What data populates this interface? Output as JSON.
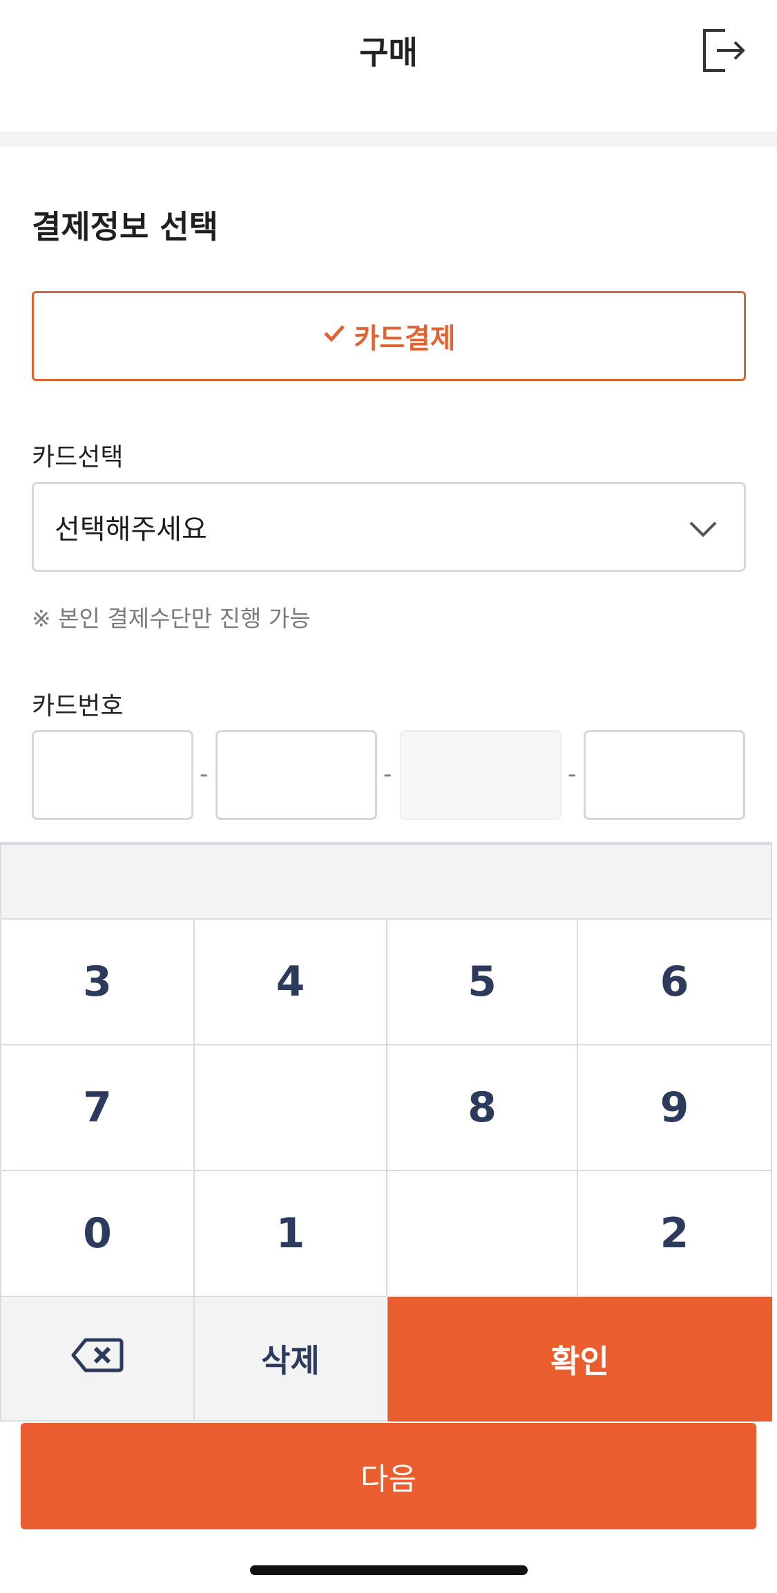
{
  "header": {
    "title": "구매",
    "exit_icon": "logout-icon"
  },
  "payment": {
    "section_title": "결제정보 선택",
    "option_label": "카드결제",
    "option_icon": "check-icon",
    "accent_color": "#e06431"
  },
  "card_select": {
    "label": "카드선택",
    "value": "선택해주세요",
    "icon": "chevron-down-icon"
  },
  "notice": "※ 본인 결제수단만 진행 가능",
  "card_number": {
    "label": "카드번호",
    "separator": "-",
    "fields": [
      "",
      "",
      "",
      ""
    ]
  },
  "keypad": {
    "rows": [
      [
        "3",
        "4",
        "5",
        "6"
      ],
      [
        "7",
        "",
        "8",
        "9"
      ],
      [
        "0",
        "1",
        "",
        "2"
      ]
    ],
    "backspace_icon": "backspace-icon",
    "delete_label": "삭제",
    "confirm_label": "확인",
    "confirm_color": "#ea5d2f"
  },
  "next_button": "다음"
}
